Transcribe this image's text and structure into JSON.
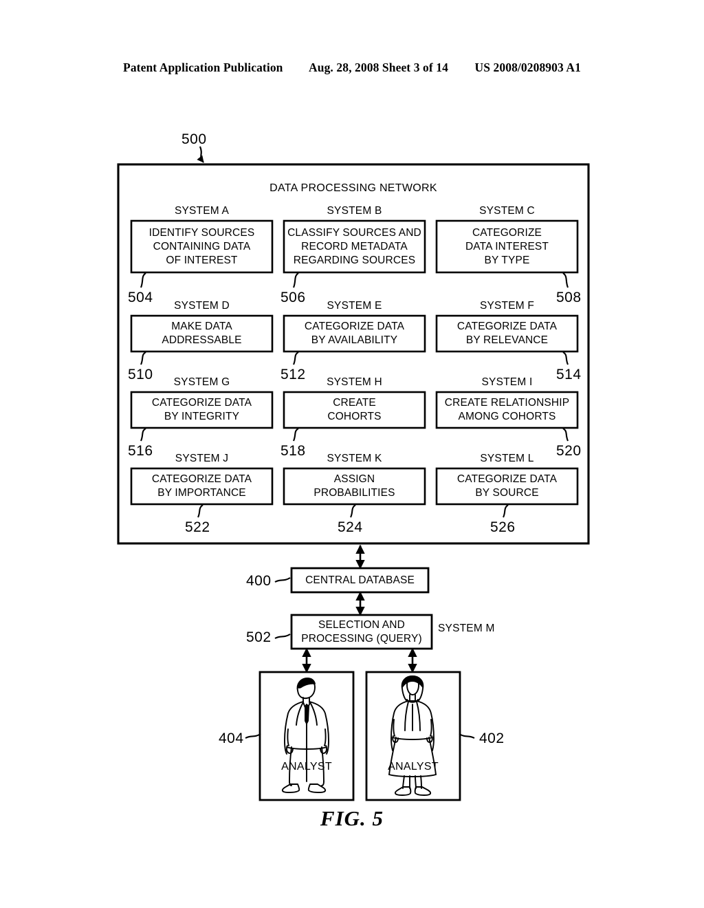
{
  "header": {
    "publication": "Patent Application Publication",
    "date_sheet": "Aug. 28, 2008  Sheet 3 of 14",
    "patent_number": "US 2008/0208903 A1"
  },
  "figure": {
    "caption": "FIG. 5",
    "container_ref": "500",
    "network_title": "DATA PROCESSING NETWORK"
  },
  "systems": [
    {
      "caption": "SYSTEM A",
      "ref": "504",
      "lines": [
        "IDENTIFY SOURCES",
        "CONTAINING DATA",
        "OF INTEREST"
      ]
    },
    {
      "caption": "SYSTEM B",
      "ref": "506",
      "lines": [
        "CLASSIFY SOURCES AND",
        "RECORD METADATA",
        "REGARDING SOURCES"
      ]
    },
    {
      "caption": "SYSTEM C",
      "ref": "508",
      "lines": [
        "CATEGORIZE",
        "DATA INTEREST",
        "BY TYPE"
      ]
    },
    {
      "caption": "SYSTEM D",
      "ref": "510",
      "lines": [
        "MAKE DATA",
        "ADDRESSABLE"
      ]
    },
    {
      "caption": "SYSTEM E",
      "ref": "512",
      "lines": [
        "CATEGORIZE DATA",
        "BY AVAILABILITY"
      ]
    },
    {
      "caption": "SYSTEM F",
      "ref": "514",
      "lines": [
        "CATEGORIZE DATA",
        "BY RELEVANCE"
      ]
    },
    {
      "caption": "SYSTEM G",
      "ref": "516",
      "lines": [
        "CATEGORIZE DATA",
        "BY INTEGRITY"
      ]
    },
    {
      "caption": "SYSTEM H",
      "ref": "518",
      "lines": [
        "CREATE",
        "COHORTS"
      ]
    },
    {
      "caption": "SYSTEM I",
      "ref": "520",
      "lines": [
        "CREATE RELATIONSHIP",
        "AMONG COHORTS"
      ]
    },
    {
      "caption": "SYSTEM J",
      "ref": "522",
      "lines": [
        "CATEGORIZE DATA",
        "BY IMPORTANCE"
      ]
    },
    {
      "caption": "SYSTEM K",
      "ref": "524",
      "lines": [
        "ASSIGN",
        "PROBABILITIES"
      ]
    },
    {
      "caption": "SYSTEM L",
      "ref": "526",
      "lines": [
        "CATEGORIZE DATA",
        "BY SOURCE"
      ]
    }
  ],
  "lower": {
    "database": {
      "ref": "400",
      "label": "CENTRAL DATABASE"
    },
    "query": {
      "ref": "502",
      "lines": [
        "SELECTION AND",
        "PROCESSING (QUERY)"
      ],
      "side_caption": "SYSTEM M"
    }
  },
  "analysts": [
    {
      "ref": "404",
      "label": "ANALYST",
      "figure": "male-analyst-icon"
    },
    {
      "ref": "402",
      "label": "ANALYST",
      "figure": "female-analyst-icon"
    }
  ],
  "style": {
    "ink": "#000000",
    "paper": "#ffffff"
  }
}
